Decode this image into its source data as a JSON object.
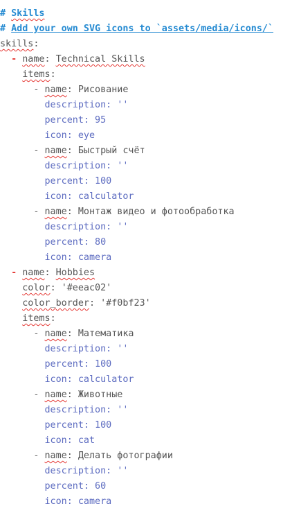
{
  "lines": [
    {
      "indent": "",
      "comment_hash": "#",
      "comment": "Skills"
    },
    {
      "indent": "",
      "comment_hash": "#",
      "comment": "Add your own SVG icons to `assets/media/icons/`"
    },
    {
      "indent": "",
      "key": "skills",
      "sep": ":"
    },
    {
      "indent": "  ",
      "dash": "-",
      "key": "name",
      "sep": ": ",
      "value": "Technical Skills"
    },
    {
      "indent": "    ",
      "key": "items",
      "sep": ":"
    },
    {
      "indent": "      ",
      "dash": "-",
      "key": "name",
      "sep": ": ",
      "value": "Рисование"
    },
    {
      "indent": "        ",
      "prop": "description: ''"
    },
    {
      "indent": "        ",
      "prop": "percent: 95"
    },
    {
      "indent": "        ",
      "prop": "icon: eye"
    },
    {
      "indent": "      ",
      "dash": "-",
      "key": "name",
      "sep": ": ",
      "value": "Быстрый счёт"
    },
    {
      "indent": "        ",
      "prop": "description: ''"
    },
    {
      "indent": "        ",
      "prop": "percent: 100"
    },
    {
      "indent": "        ",
      "prop": "icon: calculator"
    },
    {
      "indent": "      ",
      "dash": "-",
      "key": "name",
      "sep": ": ",
      "value": "Монтаж видео и фотообработка"
    },
    {
      "indent": "        ",
      "prop": "description: ''"
    },
    {
      "indent": "        ",
      "prop": "percent: 80"
    },
    {
      "indent": "        ",
      "prop": "icon: camera"
    },
    {
      "indent": "  ",
      "dash": "-",
      "key": "name",
      "sep": ": ",
      "value": "Hobbies"
    },
    {
      "indent": "    ",
      "key": "color",
      "sep": ": ",
      "value": "'#eeac02'"
    },
    {
      "indent": "    ",
      "key": "color_border",
      "sep": ": ",
      "value": "'#f0bf23'"
    },
    {
      "indent": "    ",
      "key": "items",
      "sep": ":"
    },
    {
      "indent": "      ",
      "dash": "-",
      "key": "name",
      "sep": ": ",
      "value": "Математика"
    },
    {
      "indent": "        ",
      "prop": "description: ''"
    },
    {
      "indent": "        ",
      "prop": "percent: 100"
    },
    {
      "indent": "        ",
      "prop": "icon: calculator"
    },
    {
      "indent": "      ",
      "dash": "-",
      "key": "name",
      "sep": ": ",
      "value": "Животные"
    },
    {
      "indent": "        ",
      "prop": "description: ''"
    },
    {
      "indent": "        ",
      "prop": "percent: 100"
    },
    {
      "indent": "        ",
      "prop": "icon: cat"
    },
    {
      "indent": "      ",
      "dash": "-",
      "key": "name",
      "sep": ": ",
      "value": "Делать фотографии"
    },
    {
      "indent": "        ",
      "prop": "description: ''"
    },
    {
      "indent": "        ",
      "prop": "percent: 60"
    },
    {
      "indent": "        ",
      "prop": "icon: camera"
    }
  ]
}
